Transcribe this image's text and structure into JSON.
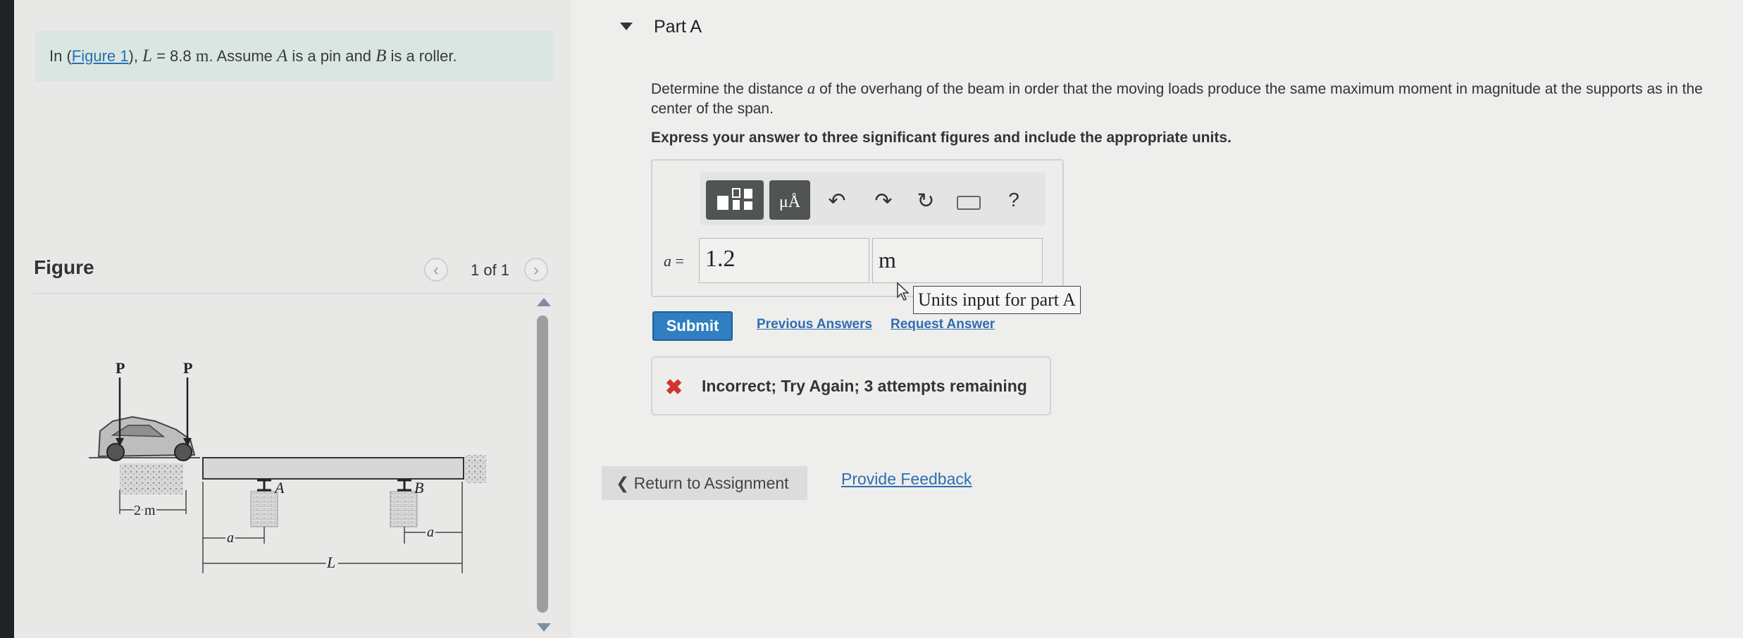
{
  "problem": {
    "prefix": "In (",
    "figure_link": "Figure 1",
    "middle": "), ",
    "l_var": "L",
    "equals": " = 8.8 ",
    "l_unit": "m",
    "assume": ". Assume ",
    "a_var": "A",
    "pin": " is a pin and ",
    "b_var": "B",
    "roller": " is a roller."
  },
  "figure": {
    "title": "Figure",
    "pager": "1 of 1",
    "prev_icon": "chevron-left-icon",
    "next_icon": "chevron-right-icon",
    "labels": {
      "p1": "P",
      "p2": "P",
      "support_a": "A",
      "support_b": "B",
      "wheelbase": "2 m",
      "overhang_left": "a",
      "overhang_right": "a",
      "span": "L"
    }
  },
  "part_a": {
    "title": "Part A",
    "question_before": "Determine the distance ",
    "question_var": "a",
    "question_after": " of the overhang of the beam in order that the moving loads produce the same maximum moment in magnitude at the supports as in the center of the span.",
    "instructions": "Express your answer to three significant figures and include the appropriate units."
  },
  "toolbar": {
    "units_label": "μÅ",
    "help_label": "?",
    "undo_glyph": "↶",
    "redo_glyph": "↷",
    "reset_glyph": "↻"
  },
  "answer": {
    "var_label": "a",
    "equals": " =",
    "value": "1.2",
    "unit": "m",
    "unit_tooltip": "Units input for part A"
  },
  "actions": {
    "submit": "Submit",
    "previous_answers": "Previous Answers",
    "request_answer": "Request Answer"
  },
  "feedback": {
    "icon": "✖",
    "message": "Incorrect; Try Again; 3 attempts remaining"
  },
  "footer": {
    "return_icon": "❮",
    "return_label": " Return to Assignment",
    "provide_feedback": "Provide Feedback"
  },
  "colors": {
    "link": "#2f6db0",
    "submit": "#2f7fc2",
    "error": "#d4332d",
    "problem_bg": "#d9e6e2"
  }
}
